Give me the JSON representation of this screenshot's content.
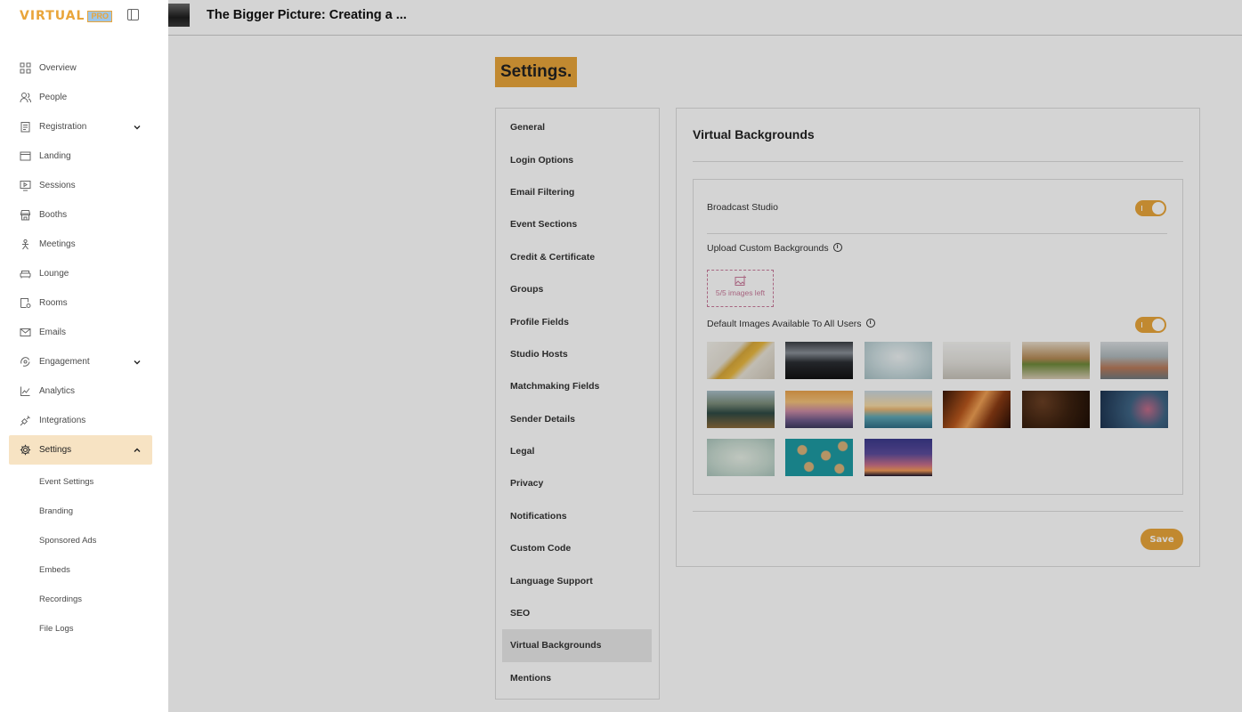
{
  "sidebar": {
    "logo": {
      "text": "VIRTUAL",
      "badge": "PRO"
    },
    "items": [
      {
        "label": "Overview",
        "icon": "grid-icon"
      },
      {
        "label": "People",
        "icon": "people-icon"
      },
      {
        "label": "Registration",
        "icon": "clipboard-icon",
        "expandable": true
      },
      {
        "label": "Landing",
        "icon": "browser-icon"
      },
      {
        "label": "Sessions",
        "icon": "play-screen-icon"
      },
      {
        "label": "Booths",
        "icon": "storefront-icon"
      },
      {
        "label": "Meetings",
        "icon": "meeting-icon"
      },
      {
        "label": "Lounge",
        "icon": "sofa-icon"
      },
      {
        "label": "Rooms",
        "icon": "room-icon"
      },
      {
        "label": "Emails",
        "icon": "mail-icon"
      },
      {
        "label": "Engagement",
        "icon": "engagement-icon",
        "expandable": true
      },
      {
        "label": "Analytics",
        "icon": "chart-line-icon"
      },
      {
        "label": "Integrations",
        "icon": "plug-icon"
      },
      {
        "label": "Settings",
        "icon": "gear-icon",
        "expandable": true,
        "active": true
      }
    ],
    "sub_items": [
      "Event Settings",
      "Branding",
      "Sponsored Ads",
      "Embeds",
      "Recordings",
      "File Logs"
    ]
  },
  "header": {
    "event_title": "The Bigger Picture: Creating a ..."
  },
  "page": {
    "title": "Settings."
  },
  "settings_menu": {
    "items": [
      "General",
      "Login Options",
      "Email Filtering",
      "Event Sections",
      "Credit & Certificate",
      "Groups",
      "Profile Fields",
      "Studio Hosts",
      "Matchmaking Fields",
      "Sender Details",
      "Legal",
      "Privacy",
      "Notifications",
      "Custom Code",
      "Language Support",
      "SEO",
      "Virtual Backgrounds",
      "Mentions"
    ],
    "active": "Virtual Backgrounds"
  },
  "virtual_backgrounds": {
    "title": "Virtual Backgrounds",
    "broadcast_studio_label": "Broadcast Studio",
    "broadcast_studio_enabled": true,
    "upload_label": "Upload Custom Backgrounds",
    "upload_remaining_text": "5/5 images left",
    "default_images_label": "Default Images Available To All Users",
    "default_images_enabled": true,
    "images": [
      "yellow-wall-room",
      "dark-office-windows",
      "white-arch-room",
      "white-kitchen",
      "cafe-plants",
      "living-room-couch",
      "lake-boat-mountains",
      "sunset-mountains",
      "beach-sunset",
      "canyon-rocks",
      "coffee-beans",
      "bokeh-blue",
      "pale-green-texture",
      "teal-seeds-pattern",
      "purple-sunset-sky"
    ],
    "save_label": "Save"
  },
  "colors": {
    "accent": "#e9a53a",
    "active_nav_bg": "#f7e3c3",
    "upload_pink": "#c97a9a"
  }
}
